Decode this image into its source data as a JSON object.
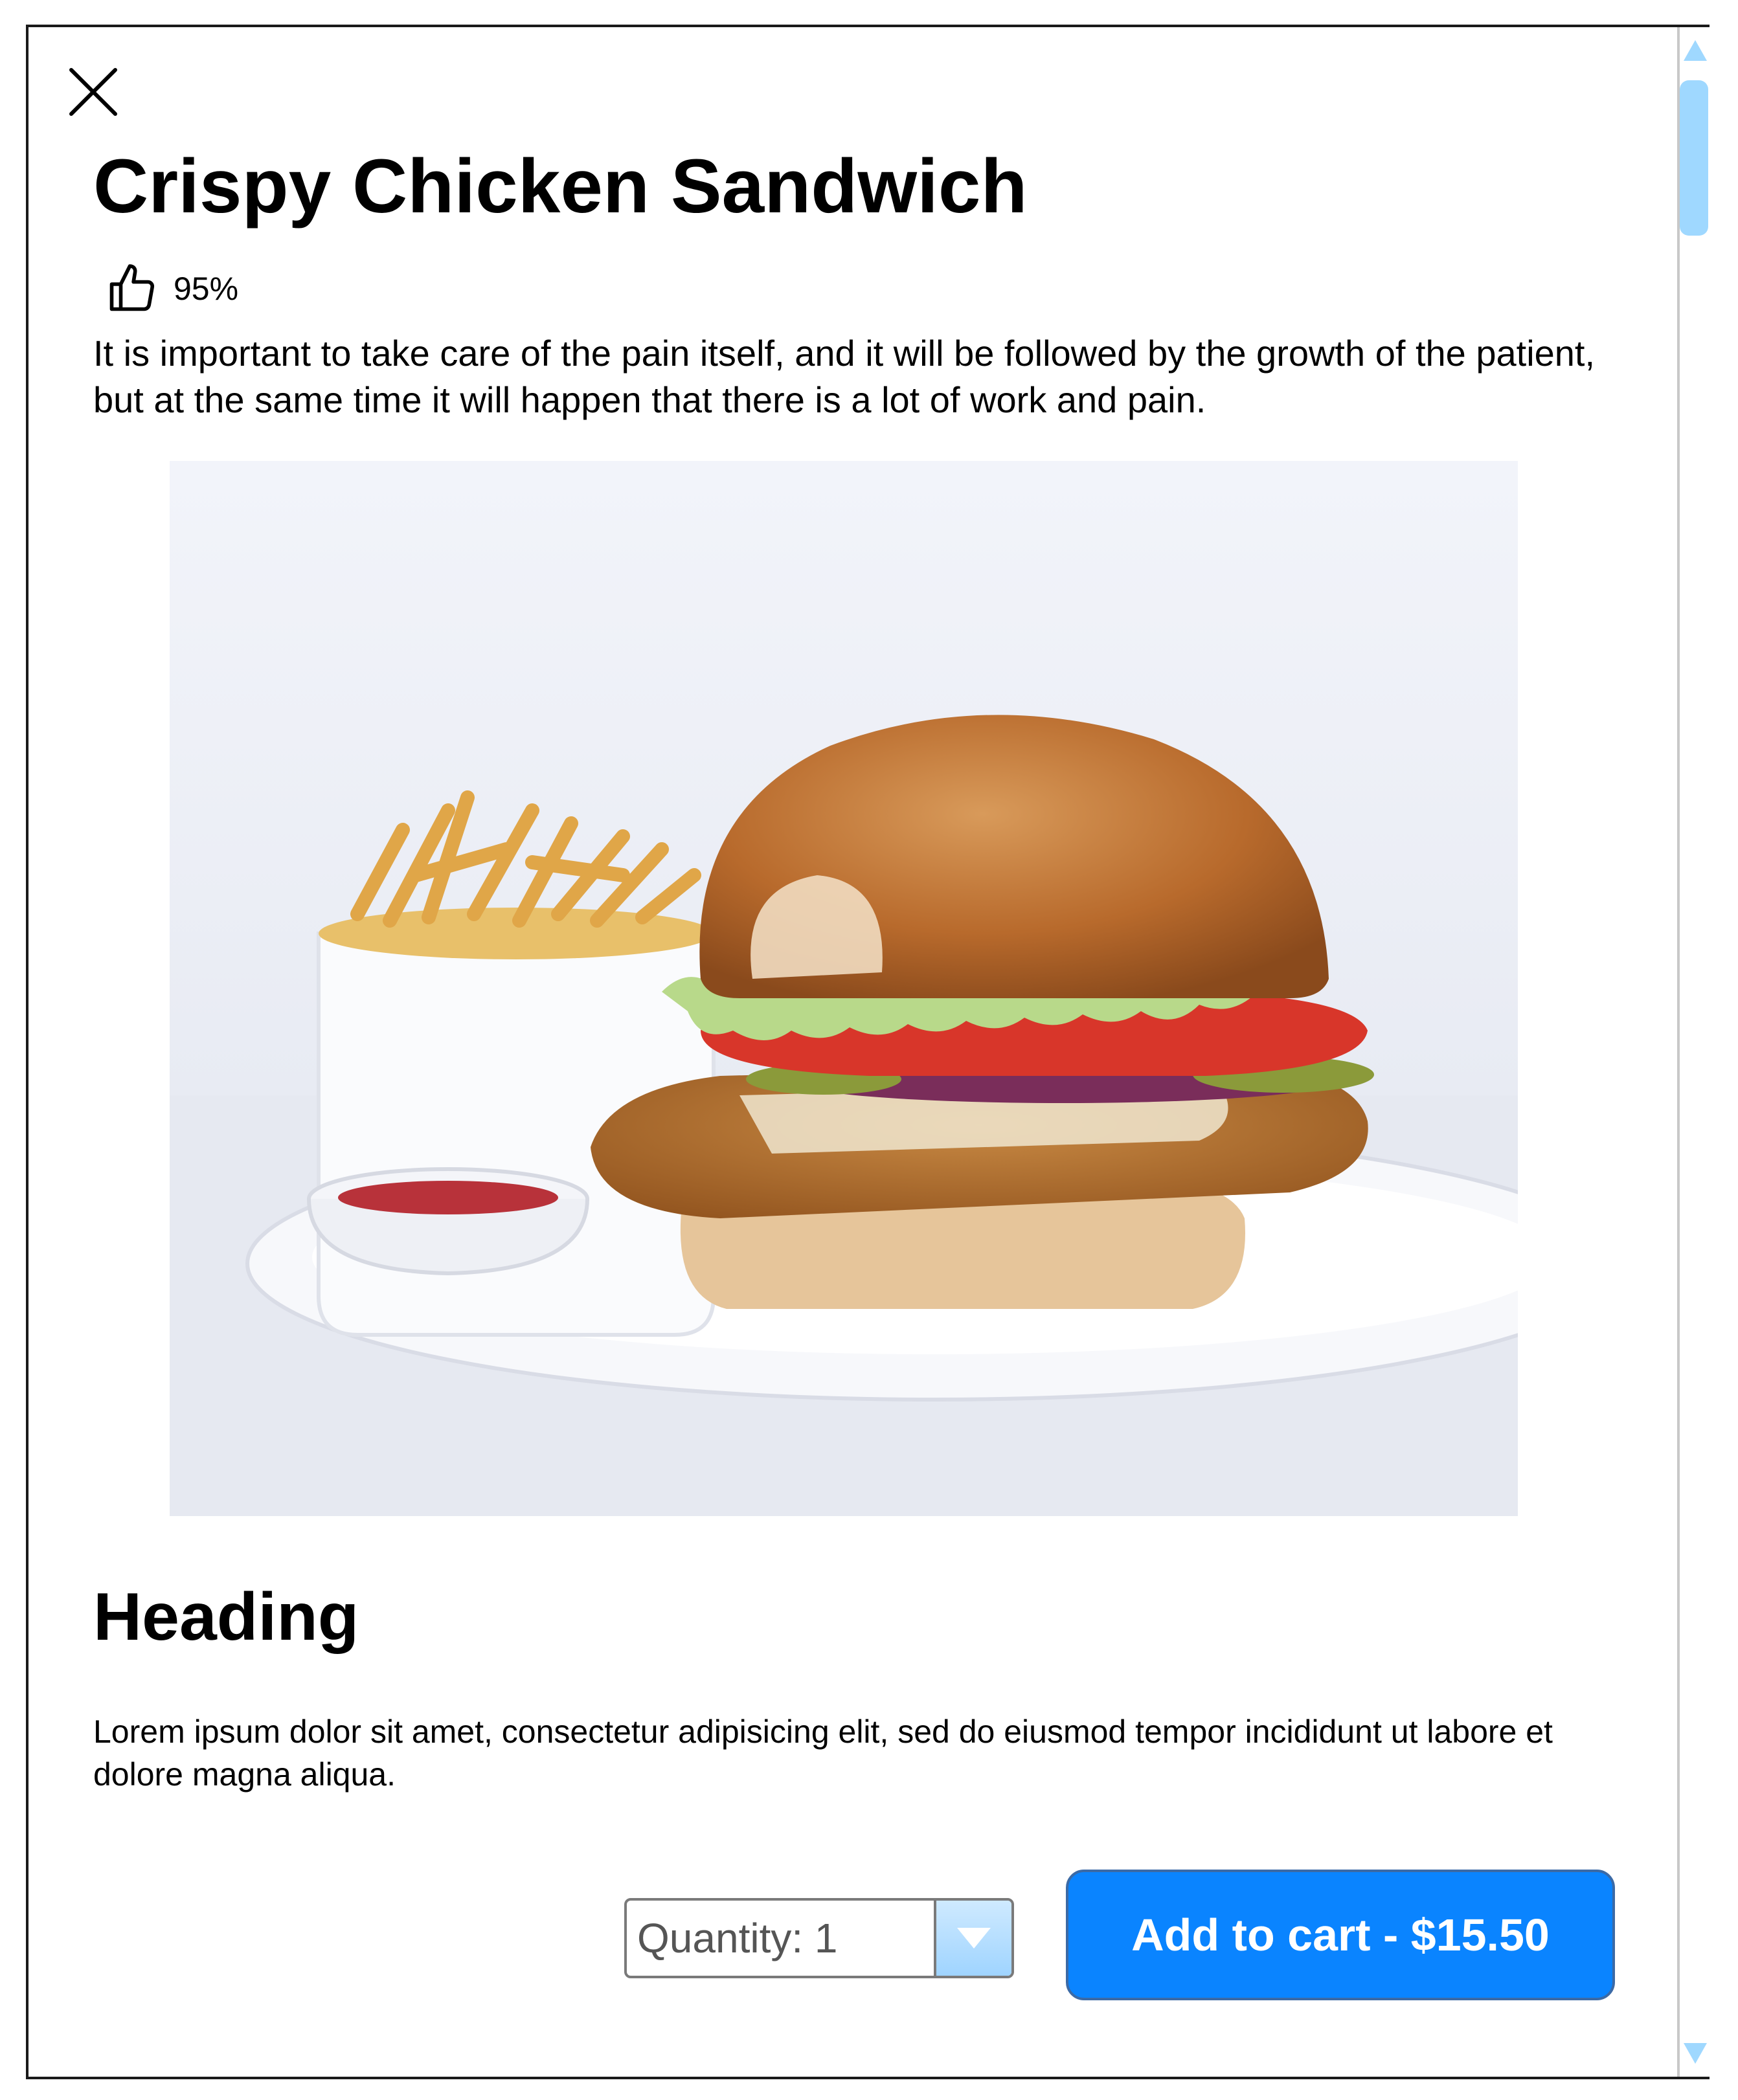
{
  "product": {
    "title": "Crispy Chicken Sandwich",
    "rating": "95%",
    "description": "It is important to take care of the pain itself, and it will be followed by the growth of the patient, but at the same time it will happen that there is a lot of work and pain."
  },
  "section": {
    "heading": "Heading",
    "body": "Lorem ipsum dolor sit amet, consectetur adipisicing elit, sed do eiusmod tempor incididunt ut labore et dolore magna aliqua."
  },
  "quantity": {
    "label": "Quantity: 1",
    "value": 1
  },
  "cart": {
    "button_label": "Add to cart - $15.50"
  },
  "colors": {
    "accent": "#0a84ff",
    "scrollbar": "#9fd8ff"
  },
  "icons": {
    "close": "close-icon",
    "rating": "thumbs-up-icon",
    "dropdown": "chevron-down-icon"
  }
}
